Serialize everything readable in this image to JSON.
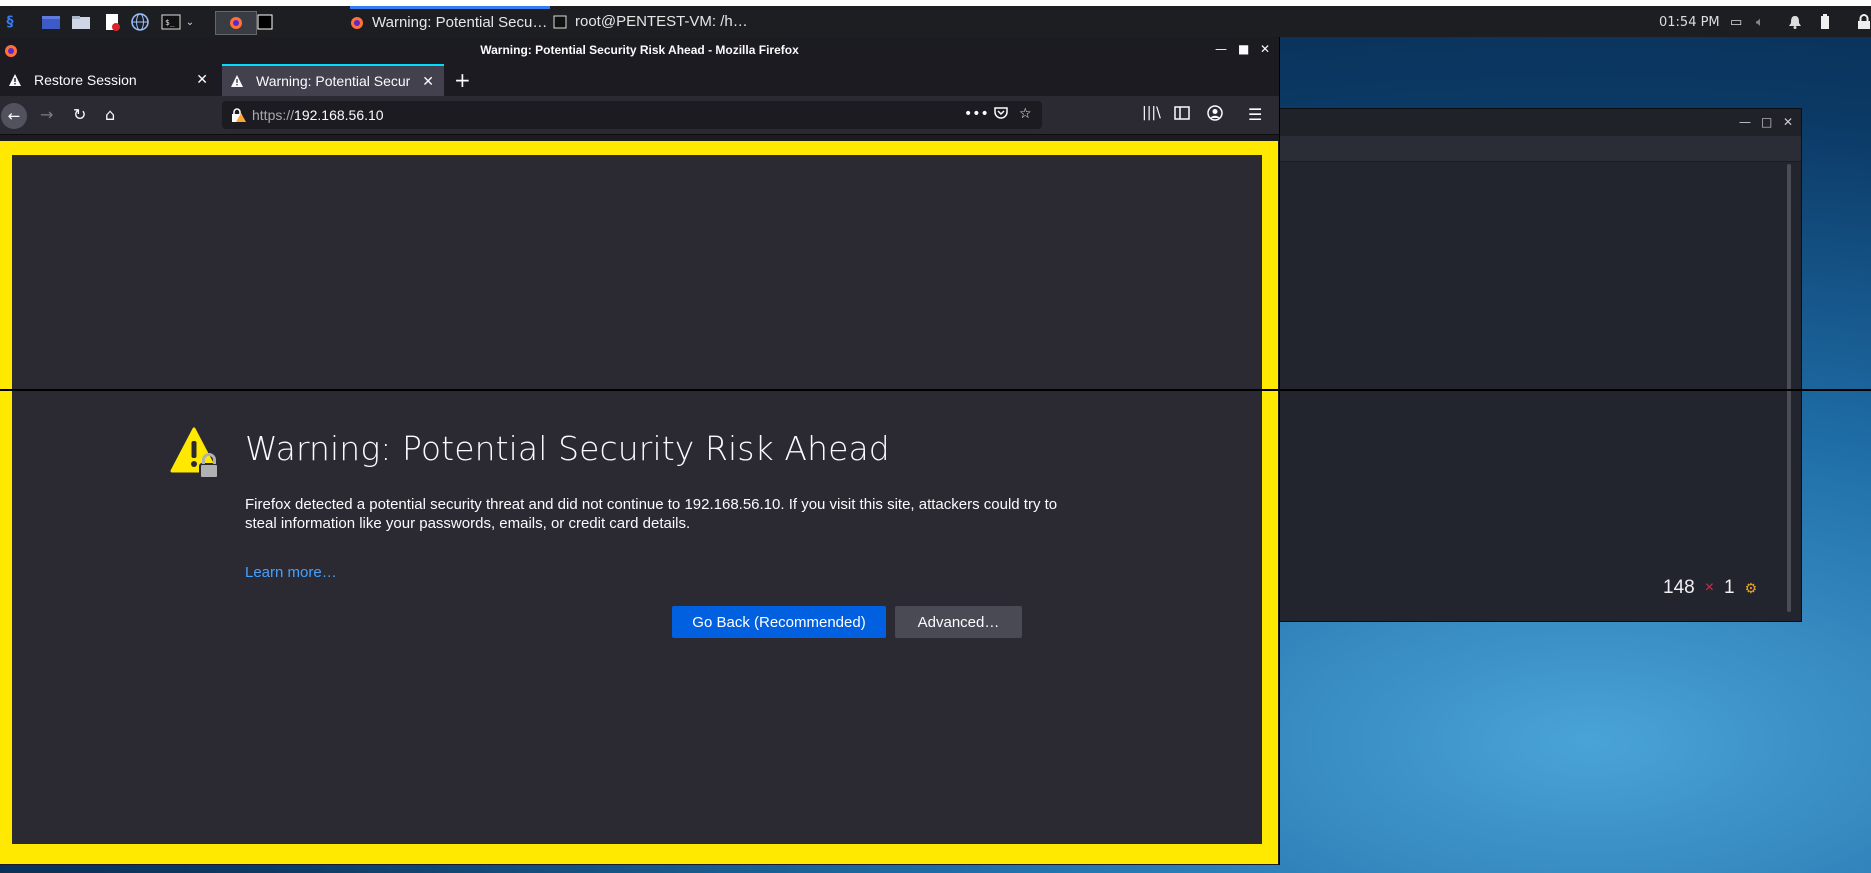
{
  "panel": {
    "tasks": [
      {
        "label": "Warning: Potential Secu…"
      },
      {
        "label": "root@PENTEST-VM: /h…"
      }
    ],
    "clock": "01:54 PM"
  },
  "firefox": {
    "window_title": "Warning: Potential Security Risk Ahead - Mozilla Firefox",
    "tabs": [
      {
        "label": "Restore Session"
      },
      {
        "label": "Warning: Potential Secur"
      }
    ],
    "url": {
      "scheme": "https://",
      "host": "192.168.56.10"
    },
    "page": {
      "heading": "Warning: Potential Security Risk Ahead",
      "description": "Firefox detected a potential security threat and did not continue to 192.168.56.10. If you visit this site, attackers could try to steal information like your passwords, emails, or credit card details.",
      "learn_more": "Learn more…",
      "go_back": "Go Back (Recommended)",
      "advanced": "Advanced…"
    }
  },
  "terminal": {
    "stat_count": "148",
    "stat_x": "×",
    "stat_one": "1",
    "stat_gear": "⚙"
  },
  "colors": {
    "accent": "#0060df",
    "highlight_border": "#ffe900",
    "link": "#45a1ff",
    "warning": "#ffe900"
  }
}
